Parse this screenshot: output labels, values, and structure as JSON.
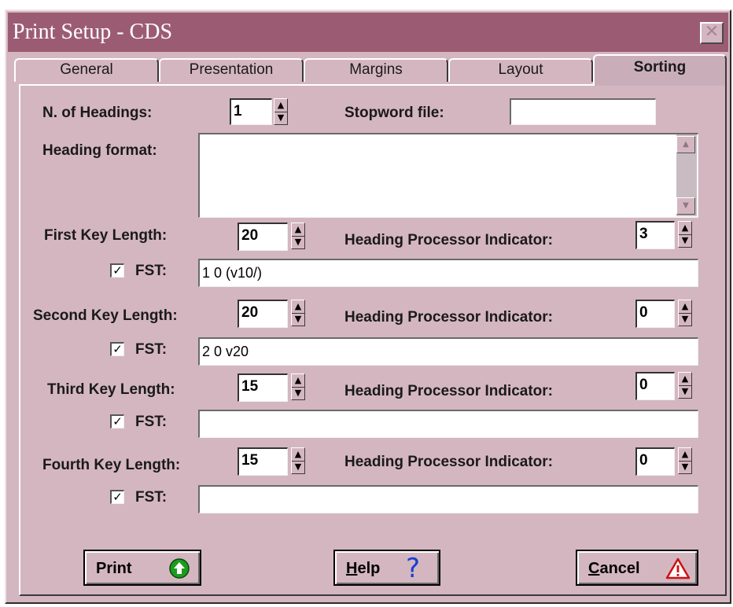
{
  "window": {
    "title": "Print Setup - CDS",
    "close_glyph": "✕"
  },
  "tabs": [
    {
      "label": "General"
    },
    {
      "label": "Presentation"
    },
    {
      "label": "Margins"
    },
    {
      "label": "Layout"
    },
    {
      "label": "Sorting",
      "active": true
    }
  ],
  "headings": {
    "count_label": "N. of Headings:",
    "count_value": "1",
    "stopword_label": "Stopword file:",
    "stopword_value": "",
    "format_label": "Heading format:",
    "format_value": ""
  },
  "keys": [
    {
      "length_label": "First Key Length:",
      "length_value": "20",
      "indicator_label": "Heading Processor Indicator:",
      "indicator_value": "3",
      "fst_label": "FST:",
      "fst_checked": true,
      "fst_value": "1 0 (v10/)"
    },
    {
      "length_label": "Second Key Length:",
      "length_value": "20",
      "indicator_label": "Heading Processor Indicator:",
      "indicator_value": "0",
      "fst_label": "FST:",
      "fst_checked": true,
      "fst_value": "2 0 v20"
    },
    {
      "length_label": "Third Key Length:",
      "length_value": "15",
      "indicator_label": "Heading Processor Indicator:",
      "indicator_value": "0",
      "fst_label": "FST:",
      "fst_checked": true,
      "fst_value": ""
    },
    {
      "length_label": "Fourth Key Length:",
      "length_value": "15",
      "indicator_label": "Heading Processor Indicator:",
      "indicator_value": "0",
      "fst_label": "FST:",
      "fst_checked": true,
      "fst_value": ""
    }
  ],
  "buttons": {
    "print": {
      "label": "Print",
      "icon": "green-up-arrow-icon"
    },
    "help": {
      "label_mnemonic": "H",
      "label_rest": "elp",
      "icon": "question-mark-icon",
      "icon_glyph": "?"
    },
    "cancel": {
      "label_mnemonic": "C",
      "label_rest": "ancel",
      "icon": "warning-triangle-icon"
    }
  },
  "glyphs": {
    "check": "✓",
    "spin_up": "▲",
    "spin_down": "▼"
  },
  "colors": {
    "title_bar": "#9b5c73",
    "dialog_bg": "#d4b6c1",
    "print_icon": "#1e9b1e",
    "help_icon": "#1a3fd0",
    "cancel_icon": "#d01010"
  }
}
